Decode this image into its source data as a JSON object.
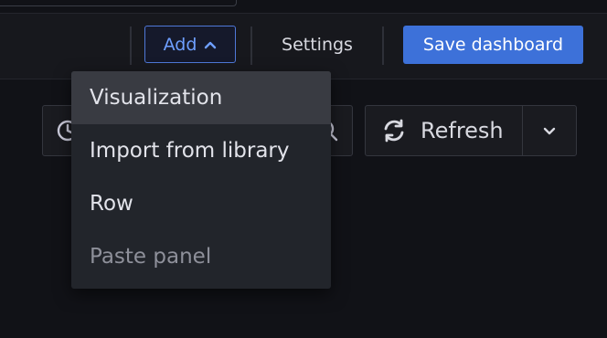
{
  "toolbar": {
    "add_label": "Add",
    "settings_label": "Settings",
    "save_label": "Save dashboard"
  },
  "time_controls": {
    "refresh_label": "Refresh"
  },
  "add_menu": {
    "items": [
      {
        "label": "Visualization",
        "state": "highlighted"
      },
      {
        "label": "Import from library",
        "state": "enabled"
      },
      {
        "label": "Row",
        "state": "enabled"
      },
      {
        "label": "Paste panel",
        "state": "disabled"
      }
    ]
  },
  "icons": {
    "add_chevron": "chevron-up-icon",
    "refresh": "refresh-icon",
    "refresh_menu": "chevron-down-icon",
    "time_picker": "clock-icon",
    "zoom": "zoom-out-icon"
  },
  "colors": {
    "background": "#111217",
    "toolbar": "#17181d",
    "accent": "#3d71d9",
    "add_button_border": "#4f78d8",
    "menu_background": "#22252b",
    "menu_highlight": "#393b42"
  }
}
